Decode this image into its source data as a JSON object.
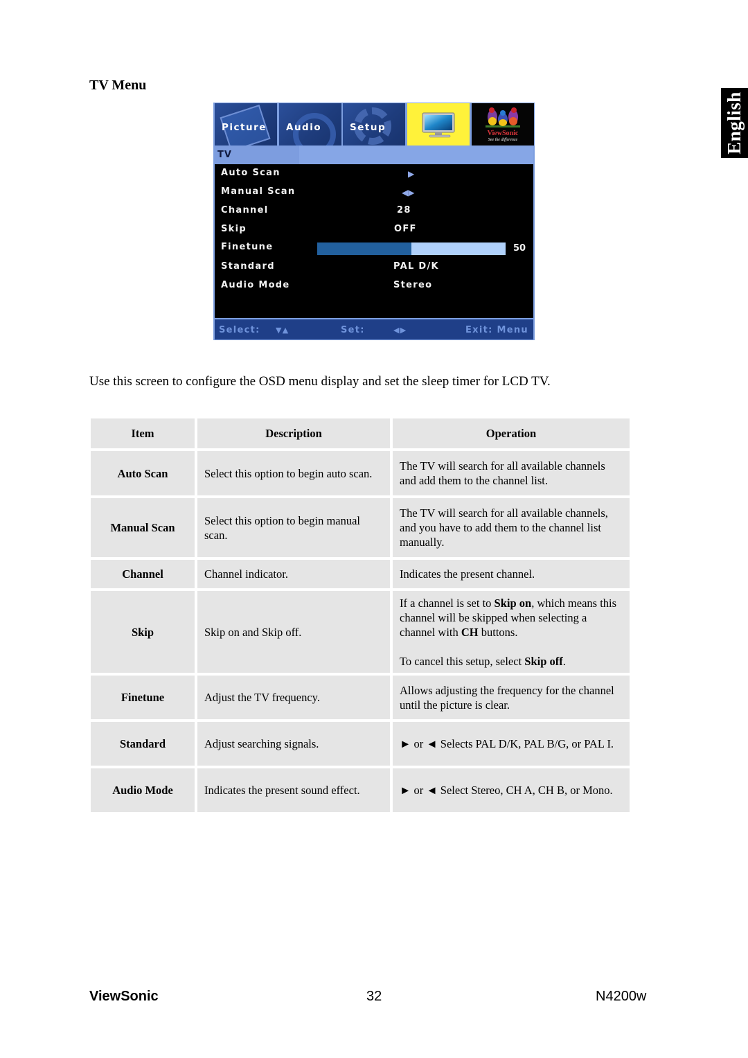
{
  "section_title": "TV Menu",
  "language_tab": "English",
  "osd": {
    "tabs": [
      {
        "label": "Picture",
        "icon": "picture-icon"
      },
      {
        "label": "Audio",
        "icon": "speaker-icon"
      },
      {
        "label": "Setup",
        "icon": "gear-icon"
      },
      {
        "label": "",
        "icon": "tv-icon",
        "selected": true
      },
      {
        "label": "",
        "icon": "viewsonic-logo"
      }
    ],
    "logo_text": "ViewSonic",
    "logo_tagline": "See the difference",
    "header": "TV",
    "rows": [
      {
        "label": "Auto Scan",
        "value": "",
        "control": "arrow-right"
      },
      {
        "label": "Manual Scan",
        "value": "",
        "control": "arrow-left-right"
      },
      {
        "label": "Channel",
        "value": "28"
      },
      {
        "label": "Skip",
        "value": "OFF"
      },
      {
        "label": "Finetune",
        "value": "50",
        "control": "slider"
      },
      {
        "label": "Standard",
        "value": "PAL D/K"
      },
      {
        "label": "Audio Mode",
        "value": "Stereo"
      }
    ],
    "finetune_percent": 50,
    "footer": {
      "select_label": "Select:",
      "select_glyph": "▼▲",
      "set_label": "Set:",
      "set_glyph": "◀▶",
      "exit_label": "Exit: Menu"
    },
    "colors": {
      "frame": "#7d9fe0",
      "body": "#000000",
      "footer": "#1f3f88",
      "tv_tab_selected": "#fff23a",
      "slider_fill": "#22609e",
      "slider_track": "#b0d1fb"
    }
  },
  "intro": "Use this screen to configure the OSD menu display and set the sleep timer for LCD TV.",
  "table": {
    "headers": [
      "Item",
      "Description",
      "Operation"
    ],
    "rows": [
      {
        "item": "Auto Scan",
        "description": "Select this option to begin auto scan.",
        "operation": "The TV will search for all available channels and add them to the channel list."
      },
      {
        "item": "Manual Scan",
        "description": "Select this option to begin manual scan.",
        "operation": "The TV will search for all available channels, and you have to add them to the channel list manually."
      },
      {
        "item": "Channel",
        "description": "Channel indicator.",
        "operation": "Indicates the present channel."
      },
      {
        "item": "Skip",
        "description": "Skip on and Skip off.",
        "operation_parts": {
          "p1_a": "If a channel is set to ",
          "p1_b": "Skip on",
          "p1_c": ", which means this channel will be skipped when selecting a channel with ",
          "p1_d": "CH",
          "p1_e": " buttons.",
          "p2_a": "To cancel this setup, select ",
          "p2_b": "Skip off",
          "p2_c": "."
        }
      },
      {
        "item": "Finetune",
        "description": "Adjust the TV frequency.",
        "operation": "Allows adjusting the frequency for the channel until the picture is clear."
      },
      {
        "item": "Standard",
        "description": "Adjust searching signals.",
        "operation": "► or ◄ Selects PAL D/K, PAL B/G, or PAL I."
      },
      {
        "item": "Audio Mode",
        "description": "Indicates the present sound effect.",
        "operation": "► or ◄ Select Stereo, CH A, CH B, or Mono."
      }
    ]
  },
  "footer": {
    "brand": "ViewSonic",
    "page": "32",
    "model": "N4200w"
  }
}
